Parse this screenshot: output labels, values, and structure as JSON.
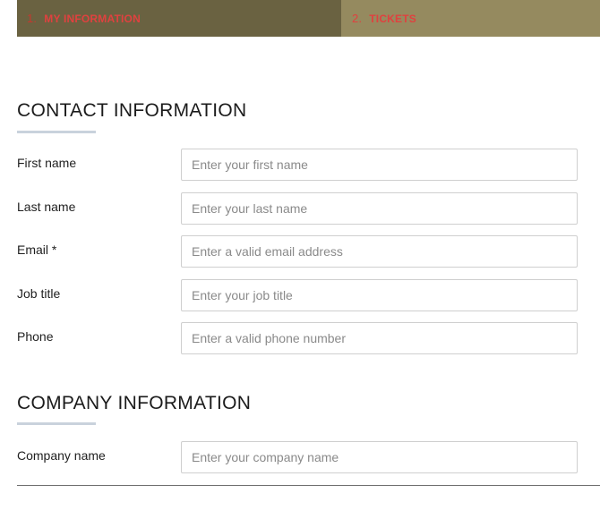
{
  "steps": [
    {
      "number": "1.",
      "label": "MY INFORMATION"
    },
    {
      "number": "2.",
      "label": "TICKETS"
    }
  ],
  "contact_section": {
    "title": "CONTACT INFORMATION",
    "fields": [
      {
        "label": "First name",
        "placeholder": "Enter your first name"
      },
      {
        "label": "Last name",
        "placeholder": "Enter your last name"
      },
      {
        "label": "Email *",
        "placeholder": "Enter a valid email address"
      },
      {
        "label": "Job title",
        "placeholder": "Enter your job title"
      },
      {
        "label": "Phone",
        "placeholder": "Enter a valid phone number"
      }
    ]
  },
  "company_section": {
    "title": "COMPANY INFORMATION",
    "fields": [
      {
        "label": "Company name",
        "placeholder": "Enter your company name"
      }
    ]
  },
  "colors": {
    "step_active_bg": "#6a6241",
    "step_inactive_bg": "#958a5f",
    "step_text": "#e0413f",
    "underline": "#c9d2dc"
  }
}
